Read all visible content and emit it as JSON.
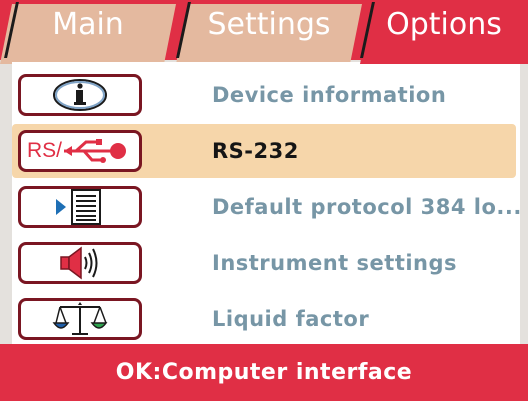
{
  "tabs": [
    {
      "label": "Main",
      "active": false
    },
    {
      "label": "Settings",
      "active": false
    },
    {
      "label": "Options",
      "active": true
    }
  ],
  "menu": {
    "items": [
      {
        "label": "Device information",
        "icon": "info-icon",
        "selected": false
      },
      {
        "label": "RS-232",
        "icon": "rs232-usb-icon",
        "icon_text": "RS/",
        "selected": true
      },
      {
        "label": "Default protocol 384 lo...",
        "icon": "protocol-list-icon",
        "selected": false
      },
      {
        "label": "Instrument settings",
        "icon": "speaker-icon",
        "selected": false
      },
      {
        "label": "Liquid factor",
        "icon": "balance-scale-icon",
        "selected": false
      }
    ]
  },
  "status": {
    "text": "OK:Computer interface"
  },
  "colors": {
    "accent": "#e02f45",
    "tab_inactive": "#e4b99f",
    "selection": "#f6d6aa",
    "label": "#7796a6",
    "icon_border": "#7a1622"
  }
}
